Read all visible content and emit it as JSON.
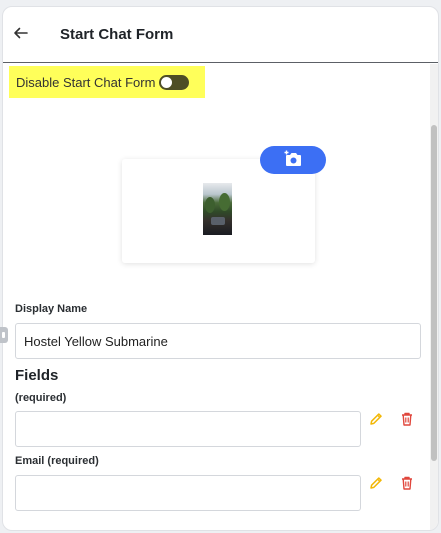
{
  "header": {
    "title": "Start Chat Form",
    "back_icon": "arrow-left-icon"
  },
  "toggle_section": {
    "label": "Disable Start Chat Form",
    "toggle_on": false,
    "highlight_color": "#ffff5a"
  },
  "image_upload": {
    "button_icon": "camera-add-icon",
    "button_color": "#3c6ff4"
  },
  "display_name": {
    "label": "Display Name",
    "value": "Hostel Yellow Submarine"
  },
  "fields": {
    "title": "Fields",
    "items": [
      {
        "label": "(required)",
        "value": "",
        "edit_icon": "pencil-icon",
        "delete_icon": "trash-icon"
      },
      {
        "label": "Email (required)",
        "value": "",
        "edit_icon": "pencil-icon",
        "delete_icon": "trash-icon"
      }
    ]
  },
  "colors": {
    "edit_icon": "#f2b705",
    "delete_icon": "#e0463c"
  }
}
